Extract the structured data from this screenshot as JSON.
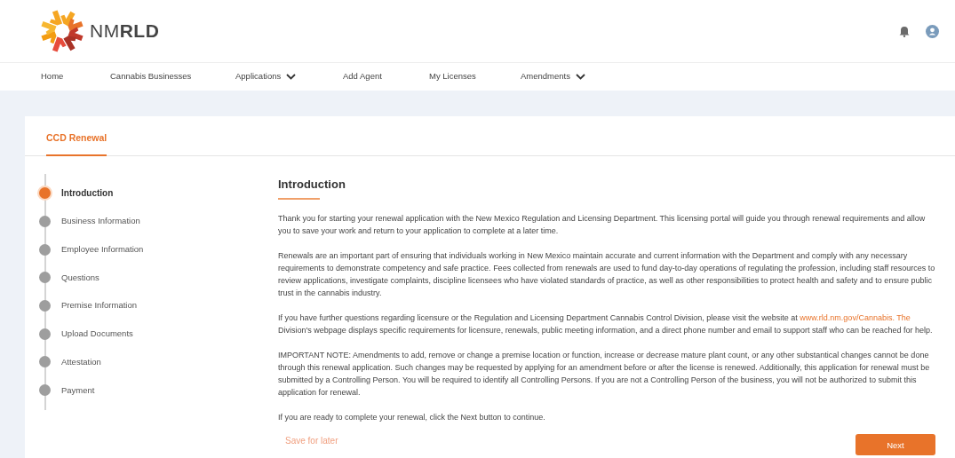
{
  "logo": {
    "text": "NM**RLD**"
  },
  "nav": [
    {
      "label": "Home",
      "dropdown": false
    },
    {
      "label": "Cannabis Businesses",
      "dropdown": false
    },
    {
      "label": "Applications",
      "dropdown": true
    },
    {
      "label": "Add Agent",
      "dropdown": false
    },
    {
      "label": "My Licenses",
      "dropdown": false
    },
    {
      "label": "Amendments",
      "dropdown": true
    }
  ],
  "tab": {
    "label": "CCD Renewal"
  },
  "steps": [
    {
      "label": "Introduction",
      "selected": true
    },
    {
      "label": "Business Information",
      "selected": false
    },
    {
      "label": "Employee Information",
      "selected": false
    },
    {
      "label": "Questions",
      "selected": false
    },
    {
      "label": "Premise Information",
      "selected": false
    },
    {
      "label": "Upload Documents",
      "selected": false
    },
    {
      "label": "Attestation",
      "selected": false
    },
    {
      "label": "Payment",
      "selected": false
    }
  ],
  "section": {
    "title": "Introduction",
    "paragraphs": [
      {
        "text": "Thank you for starting your renewal application with the New Mexico Regulation and Licensing Department. This licensing portal will guide you through renewal requirements and allow you to save your work and return to your application to complete at a later time."
      },
      {
        "text": "Renewals are an important part of ensuring that individuals working in New Mexico maintain accurate and current information with the Department and comply with any necessary requirements to demonstrate competency and safe practice. Fees collected from renewals are used to fund day-to-day operations of regulating the profession, including staff resources to review applications, investigate complaints, discipline licensees who have violated standards of practice, as well as other responsibilities to protect health and safety and to ensure public trust in the cannabis industry."
      },
      {
        "text": "If you have further questions regarding licensure or the Regulation and Licensing Department Cannabis Control Division, please visit the website at",
        "link": "www.rld.nm.gov/Cannabis. The",
        "after": "Division's webpage displays specific requirements for licensure, renewals, public meeting information, and a direct phone number and email to support staff who can be reached for help."
      },
      {
        "text": "IMPORTANT NOTE: Amendments to add, remove or change a premise location or function, increase or decrease mature plant count, or any other substantical changes cannot be done through this renewal application. Such changes may be requested by applying for an amendment before or after the license is renewed. Additionally, this application for renewal must be submitted by a Controlling Person. You will be required to identify all Controlling Persons. If you are not a Controlling Person of the business, you will not be authorized to submit this application for renewal."
      },
      {
        "text": "If you are ready to complete your renewal, click the Next button to continue."
      }
    ]
  },
  "actions": {
    "secondary": "Save for later",
    "primary": "Next"
  }
}
